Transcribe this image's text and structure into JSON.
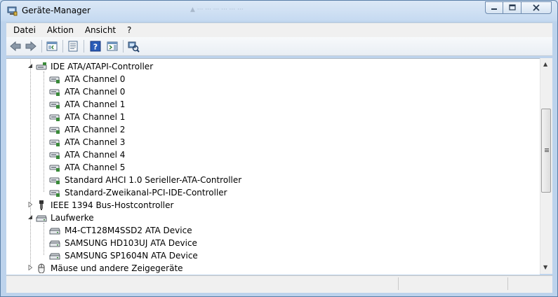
{
  "window": {
    "title": "Geräte-Manager",
    "ghost_title": "▲ ··· ··· ··· ··· ··· ···"
  },
  "menu": [
    "Datei",
    "Aktion",
    "Ansicht",
    "?"
  ],
  "toolbar": {
    "buttons": [
      "back-icon",
      "forward-icon",
      "show-hide-console-tree-icon",
      "properties-icon",
      "help-icon",
      "action-pane-icon",
      "scan-hardware-icon"
    ]
  },
  "tree": {
    "ide": {
      "label": "IDE ATA/ATAPI-Controller",
      "children": [
        "ATA Channel 0",
        "ATA Channel 0",
        "ATA Channel 1",
        "ATA Channel 1",
        "ATA Channel 2",
        "ATA Channel 3",
        "ATA Channel 4",
        "ATA Channel 5",
        "Standard AHCI 1.0 Serieller-ATA-Controller",
        "Standard-Zweikanal-PCI-IDE-Controller"
      ]
    },
    "ieee": {
      "label": "IEEE 1394 Bus-Hostcontroller"
    },
    "drives": {
      "label": "Laufwerke",
      "children": [
        "M4-CT128M4SSD2 ATA Device",
        "SAMSUNG HD103UJ ATA Device",
        "SAMSUNG SP1604N ATA Device"
      ]
    },
    "mice": {
      "label": "Mäuse und andere Zeigegeräte"
    }
  },
  "colors": {
    "title_bar": "#c6daf1",
    "controller_icon": "#3a8a3a",
    "text": "#000000"
  }
}
